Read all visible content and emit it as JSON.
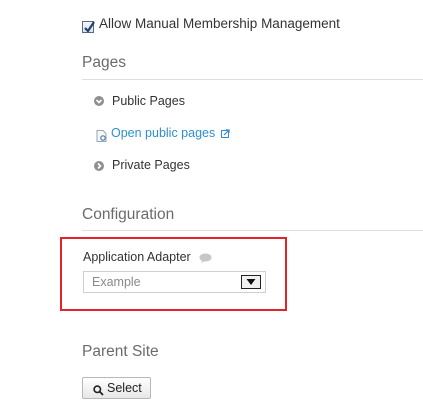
{
  "membership": {
    "checkbox_label": "Allow Manual Membership Management",
    "checked": true
  },
  "pages": {
    "title": "Pages",
    "public_label": "Public Pages",
    "open_public_link": "Open public pages",
    "private_label": "Private Pages"
  },
  "configuration": {
    "title": "Configuration",
    "adapter_label": "Application Adapter",
    "adapter_value": "Example"
  },
  "parent_site": {
    "title": "Parent Site",
    "select_button": "Select"
  },
  "icons": {
    "checkbox_check": "check-icon",
    "public_bullet": "chevron-down-icon",
    "private_bullet": "chevron-right-icon",
    "page": "page-icon",
    "external": "external-link-icon",
    "help": "help-icon",
    "dropdown": "dropdown-arrow-icon",
    "search": "search-icon"
  },
  "colors": {
    "link": "#2d8fd0",
    "highlight_border": "#e2232a",
    "section_title": "#6b6b6b"
  }
}
